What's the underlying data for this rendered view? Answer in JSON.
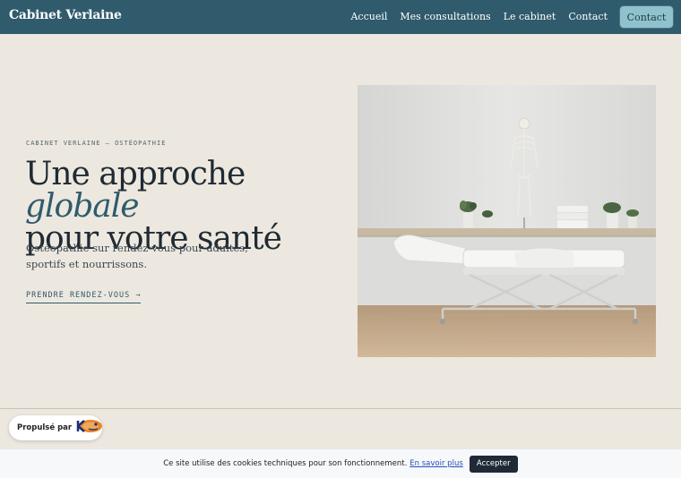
{
  "header": {
    "brand": "Cabinet Verlaine",
    "nav": [
      "Accueil",
      "Mes consultations",
      "Le cabinet",
      "Contact"
    ],
    "cta_label": "Contact"
  },
  "hero": {
    "kicker": "CABINET VERLAINE — OSTÉOPATHIE",
    "headline_before": "Une approche",
    "headline_accent": "globale",
    "headline_after": "pour votre santé",
    "lede": "Ostéopathie sur rendez-vous pour adultes, sportifs et nourrissons.",
    "cta": "PRENDRE RENDEZ-VOUS →",
    "image_icon": "treatment-room-photo"
  },
  "badge": {
    "label": "Propulsé par",
    "logo_icon": "kiwi-logo-icon"
  },
  "cookie": {
    "message": "Ce site utilise des cookies techniques pour son fonctionnement.",
    "link": "En savoir plus",
    "accept": "Accepter"
  },
  "colors": {
    "header_bg": "#2f5b6c",
    "accent": "#2f5b6c",
    "button_bg": "#8fc2cc",
    "page_bg": "#ede8df",
    "cookie_button_bg": "#1f2a36"
  }
}
